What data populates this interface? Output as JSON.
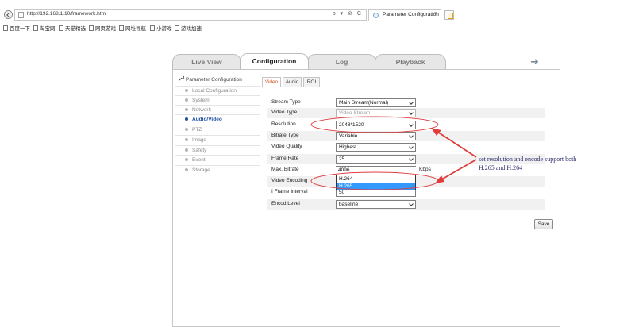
{
  "browser": {
    "url": "http://192.168.1.10/framework.html",
    "url_controls": "ρ ▾ ⊘ C",
    "tab_title": "Parameter Configuration",
    "favorites": [
      "百度一下",
      "淘宝网",
      "天猫精选",
      "网页游戏",
      "网址导航",
      "小游戏",
      "游戏加速"
    ]
  },
  "main_tabs": [
    {
      "label": "Live View",
      "active": false
    },
    {
      "label": "Configuration",
      "active": true
    },
    {
      "label": "Log",
      "active": false
    },
    {
      "label": "Playback",
      "active": false
    }
  ],
  "sidebar": {
    "title": "Parameter Configuration",
    "items": [
      {
        "label": "Local Configuration",
        "active": false
      },
      {
        "label": "System",
        "active": false
      },
      {
        "label": "Network",
        "active": false
      },
      {
        "label": "Audio/Video",
        "active": true
      },
      {
        "label": "PTZ",
        "active": false
      },
      {
        "label": "Image",
        "active": false
      },
      {
        "label": "Safety",
        "active": false
      },
      {
        "label": "Event",
        "active": false
      },
      {
        "label": "Storage",
        "active": false
      }
    ]
  },
  "sub_tabs": [
    {
      "label": "Video",
      "active": true
    },
    {
      "label": "Audio",
      "active": false
    },
    {
      "label": "ROI",
      "active": false
    }
  ],
  "form": {
    "stream_type": {
      "label": "Stream Type",
      "value": "Main Stream(Normal)"
    },
    "video_type": {
      "label": "Video Type",
      "value": "Video Stream"
    },
    "resolution": {
      "label": "Resolution",
      "value": "2048*1520"
    },
    "bitrate_type": {
      "label": "Bitrate Type",
      "value": "Variable"
    },
    "video_quality": {
      "label": "Video Quality",
      "value": "Highest"
    },
    "frame_rate": {
      "label": "Frame Rate",
      "value": "25"
    },
    "max_bitrate": {
      "label": "Max. Bitrate",
      "value": "4096",
      "unit": "Kbps"
    },
    "video_encoding": {
      "label": "Video Encoding",
      "options": [
        "H.264",
        "H.265"
      ],
      "selected": "H.265"
    },
    "i_frame_interval": {
      "label": "I Frame Interval",
      "value": "50"
    },
    "encod_level": {
      "label": "Encod Level",
      "value": "baseline"
    }
  },
  "save_label": "Save",
  "annotation": {
    "text": "set resolution and encode support both H.265 and H.264",
    "color": "#e03c3c"
  }
}
